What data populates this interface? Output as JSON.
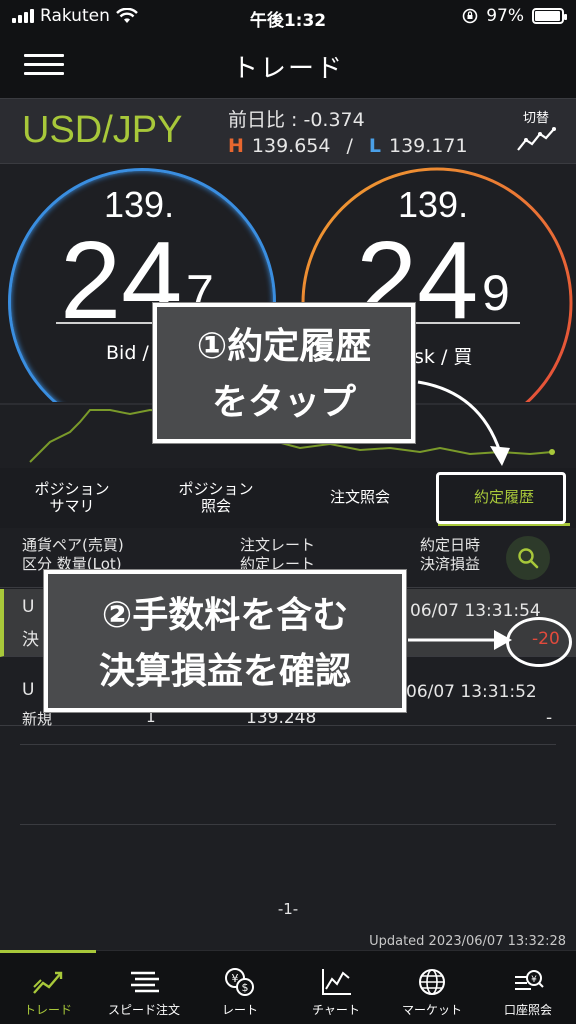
{
  "status_bar": {
    "carrier": "Rakuten",
    "time": "午後1:32",
    "battery": "97%",
    "battery_level": 0.97
  },
  "header": {
    "title": "トレード"
  },
  "pair_bar": {
    "pair": "USD/JPY",
    "change_label": "前日比 : -0.374",
    "high_mark": "H",
    "high_value": "139.654",
    "separator": "/",
    "low_mark": "L",
    "low_value": "139.171",
    "switch_label": "切替"
  },
  "quotes": {
    "bid": {
      "top": "139.",
      "big": "24",
      "small": "7",
      "label": "Bid / "
    },
    "ask": {
      "top": "139.",
      "big": "24",
      "small": "9",
      "label": "sk / 買"
    }
  },
  "tabs": [
    {
      "label": "ポジション\nサマリ"
    },
    {
      "label": "ポジション\n照会"
    },
    {
      "label": "注文照会"
    },
    {
      "label": "約定履歴",
      "active": true
    }
  ],
  "table": {
    "headers": {
      "col1_line1": "通貨ペア(売買)",
      "col1_line2": "区分 数量(Lot)",
      "col2_line1": "注文レート",
      "col2_line2": "約定レート",
      "col3_line1": "約定日時",
      "col3_line2": "決済損益"
    },
    "rows": [
      {
        "pair": "U",
        "type": "決",
        "qty": "",
        "rate": "",
        "datetime": "06/07 13:31:54",
        "pl": "-20"
      },
      {
        "pair": "U",
        "type": "新規",
        "qty": "1",
        "rate": "139.248",
        "datetime": "06/07 13:31:52",
        "pl": "-"
      }
    ]
  },
  "pager": "-1-",
  "updated": "Updated  2023/06/07 13:32:28",
  "bottom_nav": [
    {
      "label": "トレード",
      "icon": "trade-icon",
      "active": true
    },
    {
      "label": "スピード注文",
      "icon": "speed-order-icon"
    },
    {
      "label": "レート",
      "icon": "rate-icon"
    },
    {
      "label": "チャート",
      "icon": "chart-icon"
    },
    {
      "label": "マーケット",
      "icon": "globe-icon"
    },
    {
      "label": "口座照会",
      "icon": "account-icon"
    }
  ],
  "annotations": {
    "callout1_line1": "①約定履歴",
    "callout1_line2": "をタップ",
    "callout2_line1": "②手数料を含む",
    "callout2_line2": "決算損益を確認"
  },
  "colors": {
    "accent": "#a8c83a",
    "bid_ring": "#3a8ee0",
    "ask_ring": "#e4573a",
    "loss": "#e24a3c"
  }
}
